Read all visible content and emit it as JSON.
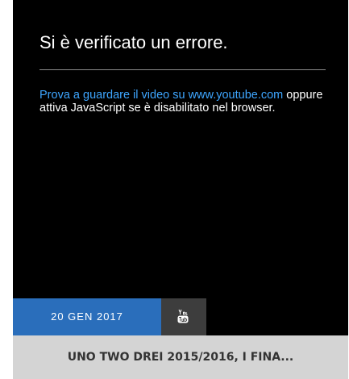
{
  "player": {
    "error_title": "Si è verificato un errore.",
    "error_link": "Prova a guardare il video su www.youtube.com",
    "error_rest": "oppure attiva JavaScript se è disabilitato nel browser."
  },
  "badge": {
    "date": "20 GEN 2017",
    "source_icon": "youtube-icon"
  },
  "post": {
    "title": "UNO TWO DREI 2015/2016, I FINA..."
  },
  "colors": {
    "player_bg": "#000000",
    "link": "#3ea6ff",
    "date_badge": "#2a6ebb",
    "youtube_badge": "#3d3d3d",
    "title_bar": "#d4d4d4"
  }
}
